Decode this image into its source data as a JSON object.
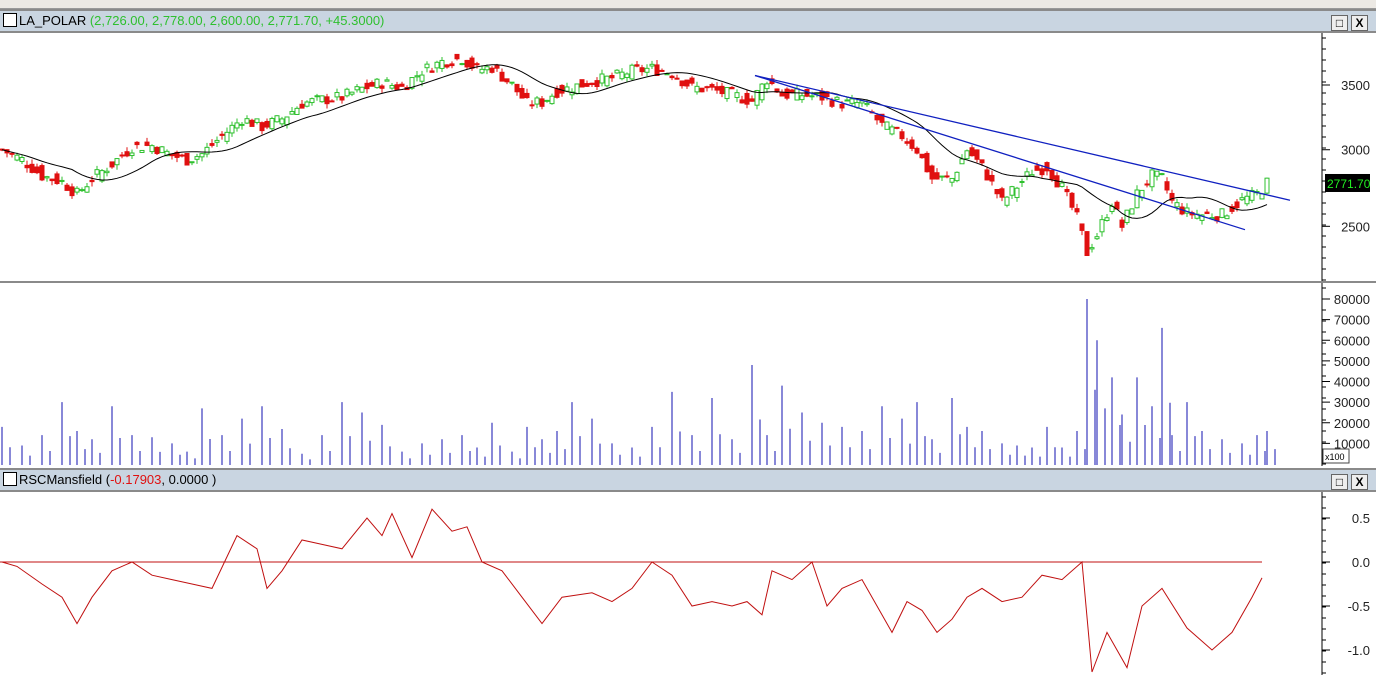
{
  "window": {
    "price_title": "LA_POLAR",
    "price_values": "(2,726.00, 2,778.00, 2,600.00, 2,771.70, +45.3000)",
    "rsc_title": "RSCMansfield",
    "rsc_values_open": "(",
    "rsc_value1": "-0.17903",
    "rsc_value2": ", 0.0000 )",
    "maximize_icon": "□",
    "close_icon": "X",
    "volume_multiplier": "x100"
  },
  "colors": {
    "up": "#2ec02e",
    "down": "#e01010",
    "ma": "#000000",
    "trend": "#1020c0",
    "volume": "#1010b0",
    "rsc": "#c01010",
    "last_bg": "#000000",
    "last_fg": "#22ee22"
  },
  "chart_data": [
    {
      "type": "candlestick",
      "name": "LA_POLAR",
      "last_price_label": "2771.70",
      "y_ticks": [
        "3500",
        "3000",
        "2500"
      ],
      "y_tick_values": [
        3500,
        3000,
        2500
      ],
      "scale": "log",
      "bars": [
        0,
        4,
        8,
        12,
        15,
        18,
        22,
        26,
        30,
        34,
        37,
        40,
        44,
        48,
        52,
        56,
        60,
        64,
        68,
        72,
        76,
        80,
        84,
        88,
        92,
        95,
        98,
        102,
        105,
        108,
        111,
        114,
        118,
        122,
        126,
        130,
        134,
        138,
        142,
        146,
        150,
        153,
        156,
        160,
        164,
        168,
        172,
        176,
        180,
        183,
        186,
        190,
        193,
        196,
        200,
        203,
        206,
        209,
        212,
        215,
        217,
        219,
        222,
        224,
        227,
        230,
        232,
        234,
        237,
        240,
        244,
        248,
        251,
        253
      ],
      "close": [
        3000,
        2930,
        2820,
        2780,
        2700,
        2800,
        2900,
        3020,
        3030,
        2960,
        2930,
        2970,
        3100,
        3230,
        3170,
        3230,
        3350,
        3380,
        3400,
        3470,
        3520,
        3480,
        3620,
        3700,
        3730,
        3630,
        3650,
        3500,
        3350,
        3360,
        3450,
        3480,
        3530,
        3560,
        3620,
        3640,
        3600,
        3480,
        3460,
        3420,
        3370,
        3550,
        3420,
        3420,
        3400,
        3350,
        3350,
        3180,
        3100,
        3000,
        2800,
        2800,
        3000,
        2880,
        2650,
        2750,
        2850,
        2880,
        2740,
        2550,
        2350,
        2450,
        2650,
        2500,
        2700,
        2820,
        2800,
        2650,
        2580,
        2570,
        2570,
        2660,
        2700,
        2772
      ],
      "trendlines": [
        {
          "from": [
            151,
            3580
          ],
          "to": [
            258,
            2660
          ]
        },
        {
          "from": [
            151,
            3580
          ],
          "to": [
            249,
            2480
          ]
        }
      ]
    },
    {
      "type": "bar",
      "name": "Volume",
      "y_ticks": [
        "80000",
        "70000",
        "60000",
        "50000",
        "40000",
        "30000",
        "20000",
        "10000"
      ],
      "y_tick_values": [
        80000,
        70000,
        60000,
        50000,
        40000,
        30000,
        20000,
        10000
      ],
      "values": [
        18000,
        9000,
        14000,
        30000,
        16000,
        12000,
        28000,
        14000,
        13000,
        10000,
        6000,
        27000,
        14000,
        22000,
        28000,
        17000,
        5000,
        14000,
        30000,
        25000,
        19000,
        6000,
        10000,
        12000,
        14000,
        8000,
        20000,
        6000,
        18000,
        12000,
        16000,
        30000,
        22000,
        10000,
        8000,
        18000,
        35000,
        14000,
        32000,
        12000,
        48000,
        14000,
        38000,
        25000,
        20000,
        18000,
        16000,
        28000,
        22000,
        30000,
        12000,
        32000,
        18000,
        16000,
        10000,
        9000,
        8000,
        18000,
        8000,
        16000,
        80000,
        60000,
        42000,
        24000,
        42000,
        28000,
        66000,
        14000,
        30000,
        16000,
        12000,
        10000,
        14000,
        16000
      ]
    },
    {
      "type": "line",
      "name": "RSCMansfield",
      "y_ticks": [
        "0.5",
        "0.0",
        "-0.5",
        "-1.0"
      ],
      "y_tick_values": [
        0.5,
        0,
        -0.5,
        -1.0
      ],
      "reference_line": 0,
      "bars": [
        0,
        3,
        8,
        12,
        15,
        18,
        22,
        26,
        30,
        34,
        38,
        42,
        47,
        51,
        53,
        56,
        60,
        64,
        68,
        73,
        76,
        78,
        82,
        86,
        90,
        93,
        96,
        100,
        104,
        108,
        112,
        118,
        122,
        126,
        130,
        134,
        138,
        142,
        146,
        149,
        152,
        154,
        158,
        162,
        165,
        168,
        172,
        175,
        178,
        181,
        184,
        187,
        190,
        193,
        196,
        200,
        204,
        208,
        212,
        216,
        218,
        221,
        225,
        228,
        232,
        237,
        242,
        246,
        250,
        252
      ],
      "values": [
        0.0,
        -0.05,
        -0.25,
        -0.4,
        -0.7,
        -0.4,
        -0.1,
        0.0,
        -0.15,
        -0.2,
        -0.25,
        -0.3,
        0.3,
        0.15,
        -0.3,
        -0.1,
        0.25,
        0.2,
        0.15,
        0.5,
        0.3,
        0.55,
        0.05,
        0.6,
        0.35,
        0.4,
        0.0,
        -0.1,
        -0.4,
        -0.7,
        -0.4,
        -0.35,
        -0.45,
        -0.3,
        0.0,
        -0.15,
        -0.5,
        -0.45,
        -0.5,
        -0.45,
        -0.6,
        -0.1,
        -0.2,
        0.0,
        -0.5,
        -0.3,
        -0.2,
        -0.5,
        -0.8,
        -0.45,
        -0.55,
        -0.8,
        -0.65,
        -0.4,
        -0.3,
        -0.45,
        -0.4,
        -0.15,
        -0.2,
        0.0,
        -1.25,
        -0.8,
        -1.2,
        -0.5,
        -0.3,
        -0.75,
        -1.0,
        -0.8,
        -0.4,
        -0.18
      ]
    }
  ]
}
